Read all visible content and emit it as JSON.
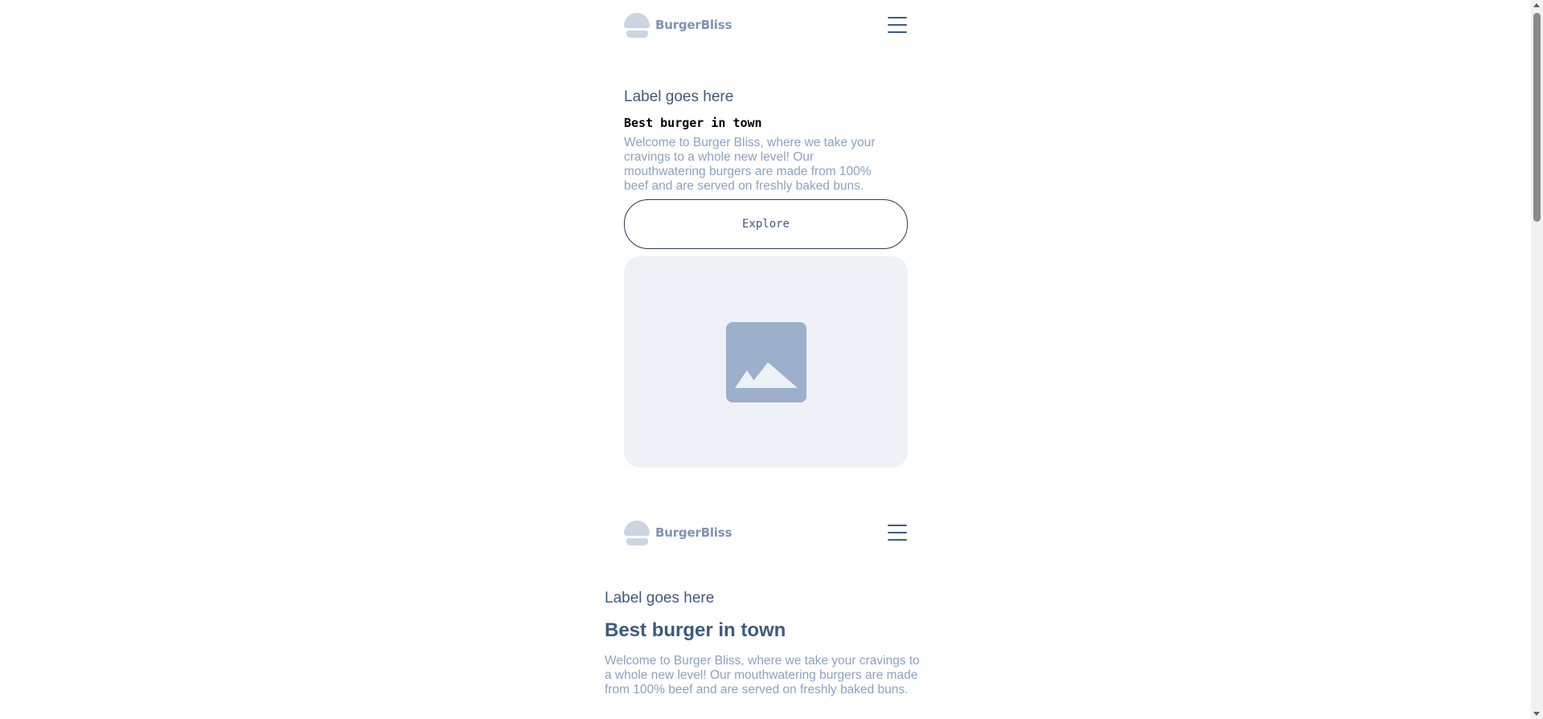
{
  "header": {
    "brand_name": "BurgerBliss",
    "logo_icon": "burger-logo-icon",
    "menu_icon": "hamburger-menu-icon"
  },
  "hero_primary": {
    "label": "Label goes here",
    "title": "Best burger in town",
    "description": "Welcome to Burger Bliss, where we take your cravings to a whole new level! Our mouthwatering burgers are made from 100% beef and are served on freshly baked buns.",
    "button_label": "Explore",
    "image_icon": "image-placeholder-icon"
  },
  "hero_secondary": {
    "label": "Label goes here",
    "title": "Best burger in town",
    "description": "Welcome to Burger Bliss, where we take your cravings to a whole new level! Our mouthwatering burgers are made from 100% beef and are served on freshly baked buns."
  },
  "colors": {
    "primary": "#3d5a80",
    "muted_text": "#8ba2c4",
    "logo": "#cbd5e1",
    "image_bg": "#eef1f6",
    "image_icon": "#9cafcb"
  }
}
